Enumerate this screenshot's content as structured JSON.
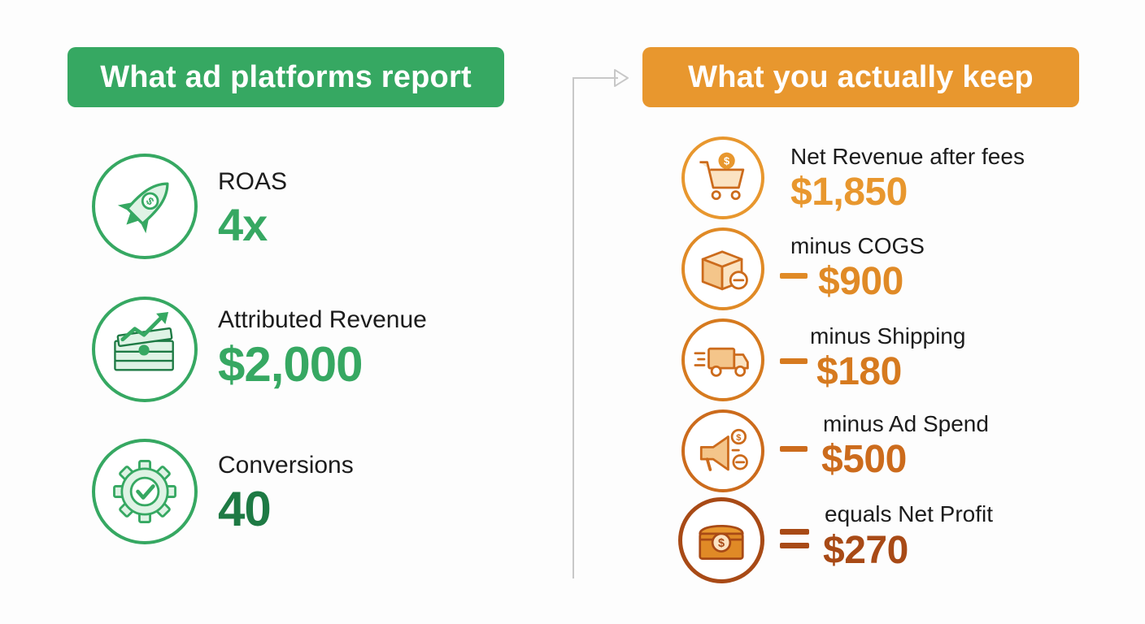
{
  "left_panel": {
    "header": "What ad platforms report",
    "color": "#36a862",
    "items": [
      {
        "label": "ROAS",
        "value": "4x",
        "icon": "rocket-dollar-icon"
      },
      {
        "label": "Attributed Revenue",
        "value": "$2,000",
        "icon": "cash-stack-growth-icon"
      },
      {
        "label": "Conversions",
        "value": "40",
        "icon": "gear-checkmark-icon"
      }
    ]
  },
  "right_panel": {
    "header": "What you actually keep",
    "color": "#e8972e",
    "items": [
      {
        "label": "Net Revenue after fees",
        "value": "$1,850",
        "operator": "",
        "icon": "shopping-cart-dollar-icon"
      },
      {
        "label": "minus COGS",
        "value": "$900",
        "operator": "minus",
        "icon": "box-minus-icon"
      },
      {
        "label": "minus Shipping",
        "value": "$180",
        "operator": "minus",
        "icon": "delivery-truck-icon"
      },
      {
        "label": "minus Ad Spend",
        "value": "$500",
        "operator": "minus",
        "icon": "megaphone-dollar-icon"
      },
      {
        "label": "equals Net Profit",
        "value": "$270",
        "operator": "equals",
        "icon": "treasure-chest-icon"
      }
    ]
  },
  "colors": {
    "green": "#36a862",
    "dark_green": "#1e7a44",
    "orange_1": "#e8972e",
    "orange_2": "#e08a26",
    "orange_3": "#d67a1f",
    "orange_4": "#cc6b1c",
    "brown": "#a84a16"
  }
}
